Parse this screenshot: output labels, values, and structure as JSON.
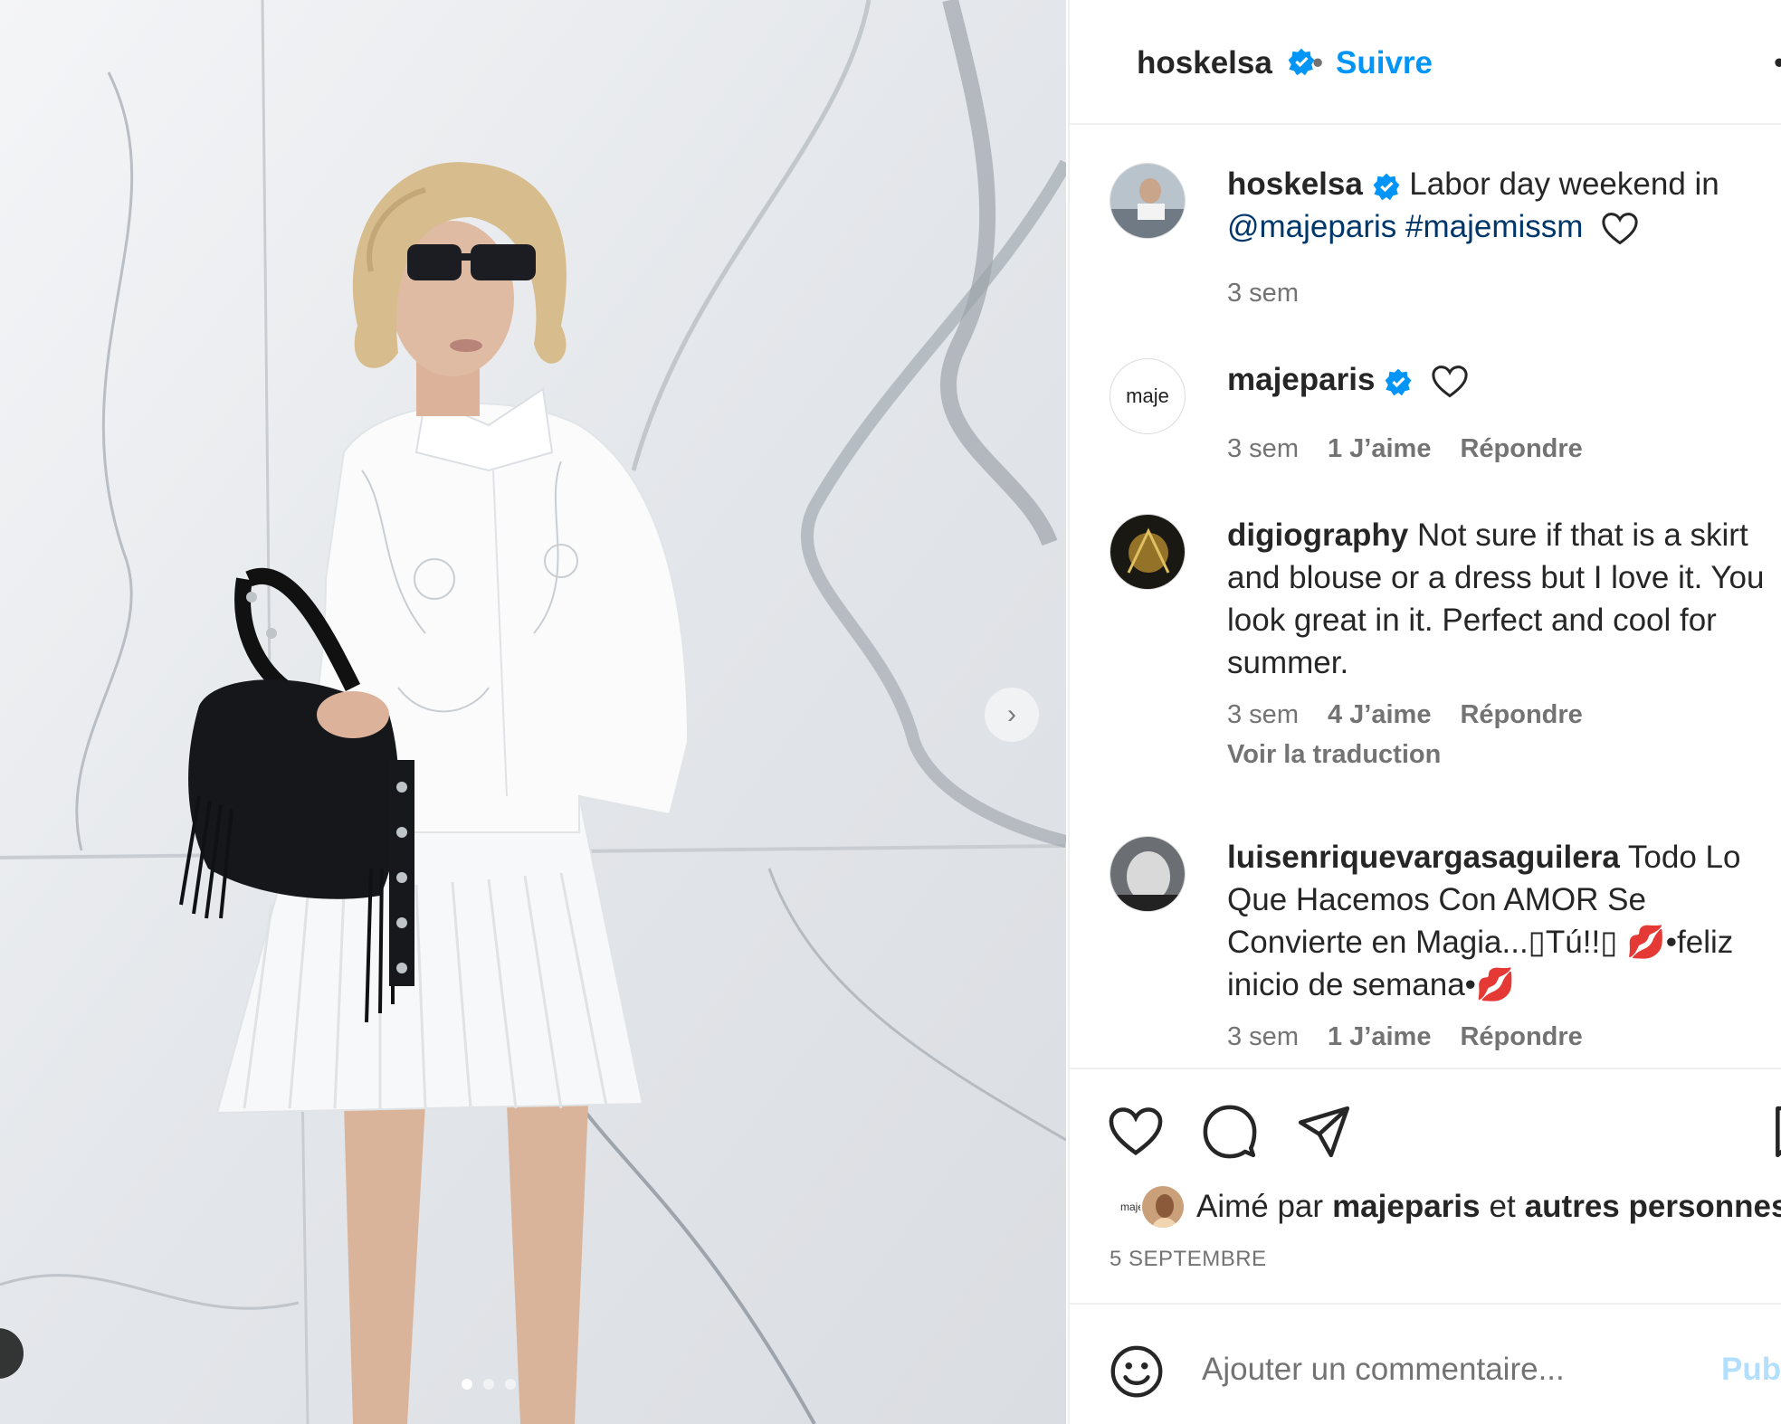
{
  "header": {
    "username": "hoskelsa",
    "separator": "•",
    "follow_label": "Suivre",
    "more_label": "•"
  },
  "caption": {
    "username": "hoskelsa",
    "text_before": "Labor day weekend in",
    "mention": "@majeparis",
    "hashtag": "#majemissm",
    "time": "3 sem"
  },
  "comments": [
    {
      "username": "majeparis",
      "text": "",
      "time": "3 sem",
      "likes": "1 J’aime",
      "reply": "Répondre",
      "avatar_text": "maje"
    },
    {
      "username": "digiography",
      "text": "Not sure if that is a skirt and blouse or a dress but I love it. You look great in it. Perfect and cool for summer.",
      "time": "3 sem",
      "likes": "4 J’aime",
      "reply": "Répondre",
      "translate": "Voir la traduction"
    },
    {
      "username": "luisenriquevargasaguilera",
      "text": "Todo Lo Que Hacemos Con AMOR Se Convierte en Magia...▯Tú!!▯ 💋•feliz inicio de semana•💋",
      "time": "3 sem",
      "likes": "1 J’aime",
      "reply": "Répondre"
    }
  ],
  "actions": {
    "like_icon": "heart-icon",
    "comment_icon": "comment-icon",
    "share_icon": "paper-plane-icon",
    "save_icon": "bookmark-icon"
  },
  "likes": {
    "prefix": "Aimé par",
    "user": "majeparis",
    "conj": "et",
    "others": "autres personnes",
    "mini_avatar_text": "maje"
  },
  "date": "5 SEPTEMBRE",
  "add_comment": {
    "placeholder": "Ajouter un commentaire...",
    "publish_label": "Publier"
  },
  "colors": {
    "link_blue": "#0095f6",
    "verified_blue": "#0095f6",
    "muted": "#737373"
  }
}
